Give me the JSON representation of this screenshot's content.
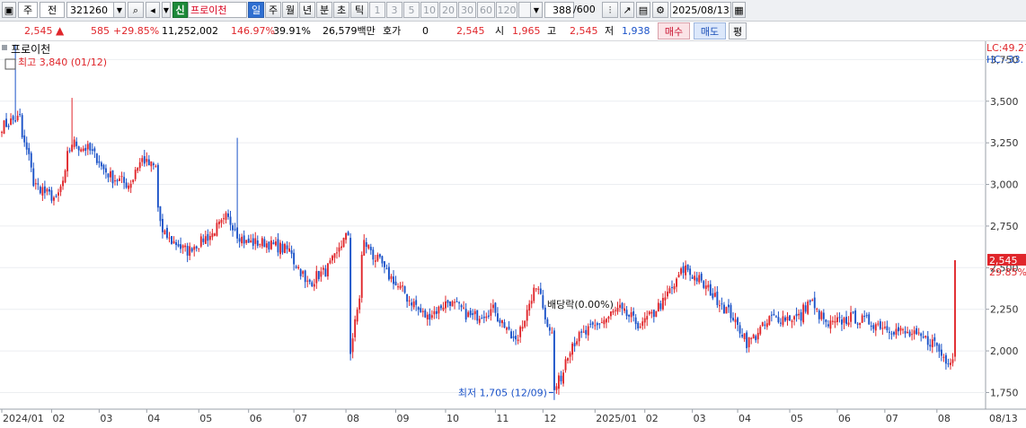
{
  "toolbar": {
    "market": "주",
    "type": "전",
    "code": "321260",
    "credit_badge": "신",
    "stock_name": "프로이천",
    "periods": [
      "일",
      "주",
      "월",
      "년",
      "분",
      "초",
      "틱"
    ],
    "active_period": "일",
    "intervals": [
      "1",
      "3",
      "5",
      "10",
      "20",
      "30",
      "60",
      "120"
    ],
    "count_value": "388",
    "count_max": "/600",
    "date": "2025/08/13"
  },
  "quote": {
    "price": "2,545",
    "change": "585",
    "change_pct": "+29.85%",
    "volume": "11,252,002",
    "volume_ratio": "146.97%",
    "turnover": "39.91%",
    "amount": "26,579백만",
    "hoga_label": "호가",
    "hoga_value": "0",
    "hoga_price": "2,545",
    "open_label": "시",
    "open": "1,965",
    "high_label": "고",
    "high": "2,545",
    "low_label": "저",
    "low": "1,938",
    "buy_label": "매수",
    "sell_label": "매도",
    "avg_label": "평"
  },
  "chart_data": {
    "type": "candlestick",
    "title": "프로이천",
    "yticks": [
      "3,750",
      "3,500",
      "3,250",
      "3,000",
      "2,750",
      "2,500",
      "2,250",
      "2,000",
      "1,750"
    ],
    "ylim": [
      1650,
      3860
    ],
    "xlabels": [
      "2024/01",
      "02",
      "03",
      "04",
      "05",
      "06",
      "07",
      "08",
      "09",
      "10",
      "11",
      "12",
      "2025/01",
      "02",
      "03",
      "04",
      "05",
      "06",
      "07",
      "08",
      "08/13"
    ],
    "right_labels": {
      "lc": "LC:49.27",
      "hc": "HC:-33.",
      "last_price": "2,545",
      "last_pct": "29.85%"
    },
    "annotations": {
      "high": "최고 3,840 (01/12)",
      "low": "최저 1,705 (12/09)",
      "dividend": "배당락(0.00%)"
    },
    "close_anchors": [
      [
        "2024-01-02",
        3350
      ],
      [
        "2024-01-12",
        3400
      ],
      [
        "2024-01-22",
        3000
      ],
      [
        "2024-02-05",
        2900
      ],
      [
        "2024-02-14",
        3250
      ],
      [
        "2024-02-26",
        3200
      ],
      [
        "2024-03-08",
        3050
      ],
      [
        "2024-03-20",
        3000
      ],
      [
        "2024-03-28",
        3150
      ],
      [
        "2024-04-05",
        3100
      ],
      [
        "2024-04-10",
        2700
      ],
      [
        "2024-04-25",
        2600
      ],
      [
        "2024-05-10",
        2700
      ],
      [
        "2024-05-20",
        2800
      ],
      [
        "2024-05-31",
        2650
      ],
      [
        "2024-06-12",
        2650
      ],
      [
        "2024-06-28",
        2600
      ],
      [
        "2024-07-08",
        2400
      ],
      [
        "2024-07-22",
        2500
      ],
      [
        "2024-08-02",
        2700
      ],
      [
        "2024-08-05",
        2000
      ],
      [
        "2024-08-13",
        2650
      ],
      [
        "2024-08-28",
        2450
      ],
      [
        "2024-09-06",
        2350
      ],
      [
        "2024-09-20",
        2200
      ],
      [
        "2024-10-04",
        2300
      ],
      [
        "2024-10-18",
        2200
      ],
      [
        "2024-11-01",
        2250
      ],
      [
        "2024-11-14",
        2050
      ],
      [
        "2024-11-22",
        2250
      ],
      [
        "2024-11-28",
        2400
      ],
      [
        "2024-12-06",
        2100
      ],
      [
        "2024-12-09",
        1760
      ],
      [
        "2024-12-19",
        2050
      ],
      [
        "2025-01-03",
        2150
      ],
      [
        "2025-01-17",
        2250
      ],
      [
        "2025-01-31",
        2150
      ],
      [
        "2025-02-14",
        2300
      ],
      [
        "2025-02-27",
        2500
      ],
      [
        "2025-03-10",
        2400
      ],
      [
        "2025-03-25",
        2250
      ],
      [
        "2025-04-07",
        2050
      ],
      [
        "2025-04-22",
        2200
      ],
      [
        "2025-05-09",
        2200
      ],
      [
        "2025-05-15",
        2300
      ],
      [
        "2025-05-26",
        2150
      ],
      [
        "2025-06-10",
        2200
      ],
      [
        "2025-06-30",
        2150
      ],
      [
        "2025-07-15",
        2100
      ],
      [
        "2025-07-31",
        2050
      ],
      [
        "2025-08-07",
        1950
      ],
      [
        "2025-08-12",
        1960
      ],
      [
        "2025-08-13",
        2545
      ]
    ]
  }
}
